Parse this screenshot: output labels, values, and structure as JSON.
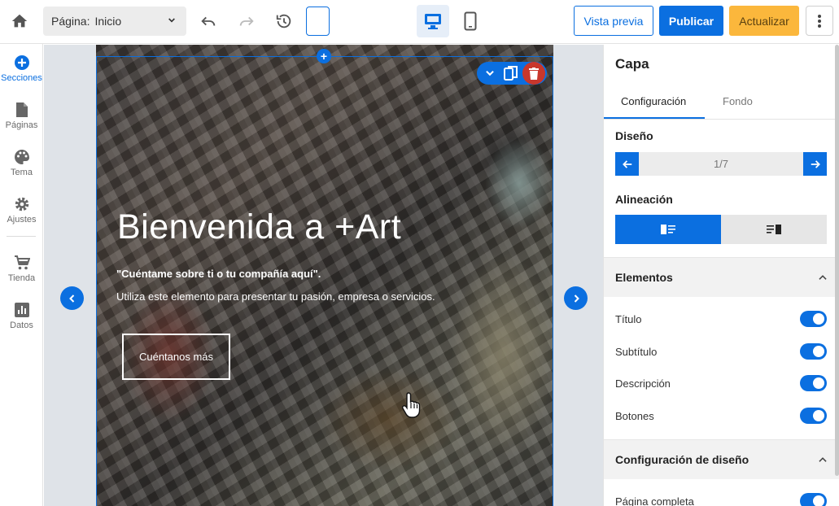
{
  "topbar": {
    "page_label": "Página:",
    "page_value": "Inicio",
    "preview_label": "Vista previa",
    "publish_label": "Publicar",
    "update_label": "Actualizar"
  },
  "sidebar": {
    "items": [
      {
        "label": "Secciones",
        "icon": "plus-circle-icon"
      },
      {
        "label": "Páginas",
        "icon": "page-icon"
      },
      {
        "label": "Tema",
        "icon": "palette-icon"
      },
      {
        "label": "Ajustes",
        "icon": "gear-icon"
      },
      {
        "label": "Tienda",
        "icon": "cart-icon"
      },
      {
        "label": "Datos",
        "icon": "chart-icon"
      }
    ]
  },
  "hero": {
    "title": "Bienvenida a +Art",
    "subtitle": "\"Cuéntame sobre ti o tu compañía aquí\".",
    "description": "Utiliza este elemento para presentar tu pasión, empresa o servicios.",
    "button_label": "Cuéntanos más"
  },
  "panel": {
    "title": "Capa",
    "tabs": [
      "Configuración",
      "Fondo"
    ],
    "design_label": "Diseño",
    "design_pager": "1/7",
    "alignment_label": "Alineación",
    "elements_header": "Elementos",
    "toggles": [
      {
        "label": "Título",
        "on": true
      },
      {
        "label": "Subtítulo",
        "on": true
      },
      {
        "label": "Descripción",
        "on": true
      },
      {
        "label": "Botones",
        "on": true
      }
    ],
    "layout_header": "Configuración de diseño",
    "layout_toggles": [
      {
        "label": "Página completa",
        "on": true
      }
    ]
  },
  "colors": {
    "accent": "#0b6fe0",
    "update": "#fbb73c",
    "delete": "#c9372c"
  }
}
